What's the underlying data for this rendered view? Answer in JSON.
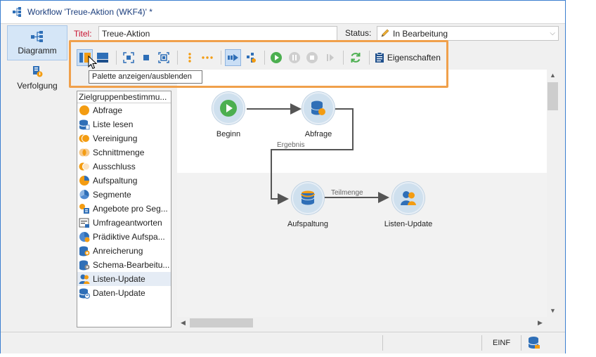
{
  "window": {
    "title": "Workflow 'Treue-Aktion (WKF4)' *"
  },
  "nav": {
    "items": [
      {
        "label": "Diagramm",
        "active": true
      },
      {
        "label": "Verfolgung",
        "active": false
      }
    ]
  },
  "form": {
    "title_label": "Titel:",
    "title_value": "Treue-Aktion",
    "status_label": "Status:",
    "status_value": "In Bearbeitung"
  },
  "toolbar": {
    "properties_label": "Eigenschaften",
    "tooltip": "Palette anzeigen/ausblenden"
  },
  "palette": {
    "header": "Zielgruppenbestimmu...",
    "items": [
      {
        "label": "Abfrage",
        "icon": "query-icon"
      },
      {
        "label": "Liste lesen",
        "icon": "read-list-icon"
      },
      {
        "label": "Vereinigung",
        "icon": "union-icon"
      },
      {
        "label": "Schnittmenge",
        "icon": "intersection-icon"
      },
      {
        "label": "Ausschluss",
        "icon": "exclusion-icon"
      },
      {
        "label": "Aufspaltung",
        "icon": "split-icon"
      },
      {
        "label": "Segmente",
        "icon": "segments-icon"
      },
      {
        "label": "Angebote pro Seg...",
        "icon": "offers-icon"
      },
      {
        "label": "Umfrageantworten",
        "icon": "survey-icon"
      },
      {
        "label": "Prädiktive Aufspa...",
        "icon": "predictive-split-icon"
      },
      {
        "label": "Anreicherung",
        "icon": "enrichment-icon"
      },
      {
        "label": "Schema-Bearbeitu...",
        "icon": "schema-edit-icon"
      },
      {
        "label": "Listen-Update",
        "icon": "list-update-icon"
      },
      {
        "label": "Daten-Update",
        "icon": "data-update-icon"
      }
    ]
  },
  "diagram": {
    "nodes": [
      {
        "id": "start",
        "label": "Beginn"
      },
      {
        "id": "query",
        "label": "Abfrage"
      },
      {
        "id": "split",
        "label": "Aufspaltung"
      },
      {
        "id": "listupdate",
        "label": "Listen-Update"
      }
    ],
    "edges": [
      {
        "label": "Ergebnis"
      },
      {
        "label": "Teilmenge"
      }
    ]
  },
  "statusbar": {
    "mode": "EINF"
  },
  "colors": {
    "accent_orange": "#f0a04b",
    "node_fill": "#cfe0ee",
    "icon_blue": "#2f6fb7",
    "icon_orange": "#f39c12",
    "play_green": "#4caf50"
  }
}
